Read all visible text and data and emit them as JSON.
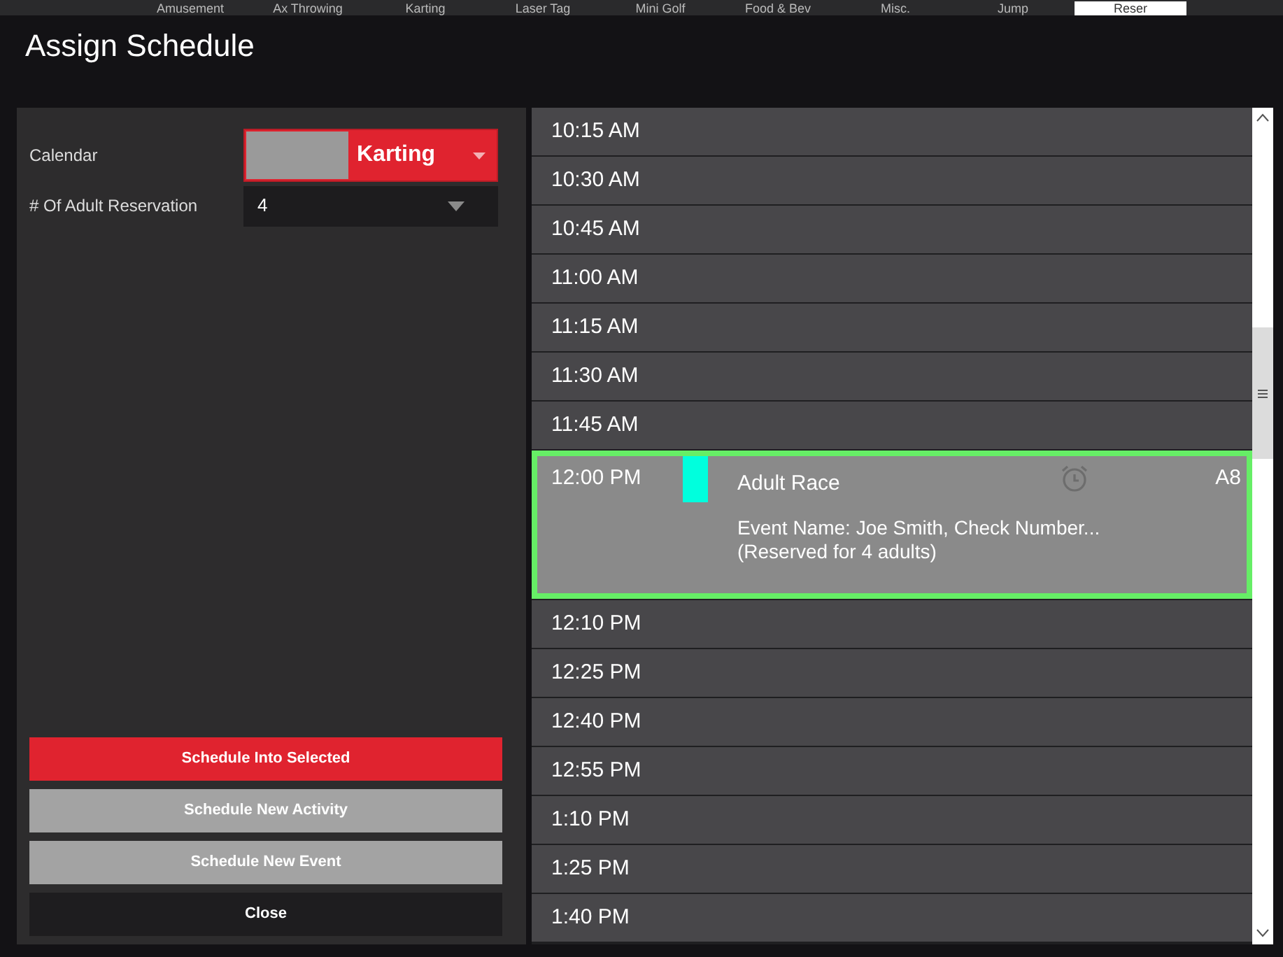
{
  "background_tabs": [
    {
      "label": "Amusement",
      "selected": false
    },
    {
      "label": "Ax Throwing",
      "selected": false
    },
    {
      "label": "Karting",
      "selected": false
    },
    {
      "label": "Laser Tag",
      "selected": false
    },
    {
      "label": "Mini Golf",
      "selected": false
    },
    {
      "label": "Food & Bev",
      "selected": false
    },
    {
      "label": "Misc.",
      "selected": false
    },
    {
      "label": "Jump",
      "selected": false
    },
    {
      "label": "Reser",
      "selected": true
    }
  ],
  "window": {
    "title": "Assign Schedule"
  },
  "form": {
    "calendar": {
      "label": "Calendar",
      "value": "Karting"
    },
    "adult_reservations": {
      "label": "# Of Adult Reservation",
      "value": "4"
    }
  },
  "buttons": [
    {
      "label": "Schedule Into Selected",
      "kind": "primary"
    },
    {
      "label": "Schedule New Activity",
      "kind": "secondary"
    },
    {
      "label": "Schedule New Event",
      "kind": "secondary"
    },
    {
      "label": "Close",
      "kind": "dark"
    }
  ],
  "schedule": [
    {
      "kind": "slot",
      "time": "10:15 AM",
      "selected": false
    },
    {
      "kind": "slot",
      "time": "10:30 AM",
      "selected": false
    },
    {
      "kind": "slot",
      "time": "10:45 AM",
      "selected": false
    },
    {
      "kind": "slot",
      "time": "11:00 AM",
      "selected": false
    },
    {
      "kind": "slot",
      "time": "11:15 AM",
      "selected": false
    },
    {
      "kind": "slot",
      "time": "11:30 AM",
      "selected": false
    },
    {
      "kind": "slot",
      "time": "11:45 AM",
      "selected": false
    },
    {
      "kind": "event",
      "time": "12:00 PM",
      "title": "Adult Race",
      "details": [
        "Event Name: Joe Smith, Check Number...",
        "(Reserved for 4 adults)"
      ],
      "code": "A8",
      "color": "#00ffdd",
      "selected": true
    },
    {
      "kind": "slot",
      "time": "12:10 PM",
      "selected": false
    },
    {
      "kind": "slot",
      "time": "12:25 PM",
      "selected": false
    },
    {
      "kind": "slot",
      "time": "12:40 PM",
      "selected": false
    },
    {
      "kind": "slot",
      "time": "12:55 PM",
      "selected": false
    },
    {
      "kind": "slot",
      "time": "1:10 PM",
      "selected": false
    },
    {
      "kind": "slot",
      "time": "1:25 PM",
      "selected": false
    },
    {
      "kind": "slot",
      "time": "1:40 PM",
      "selected": false
    }
  ]
}
